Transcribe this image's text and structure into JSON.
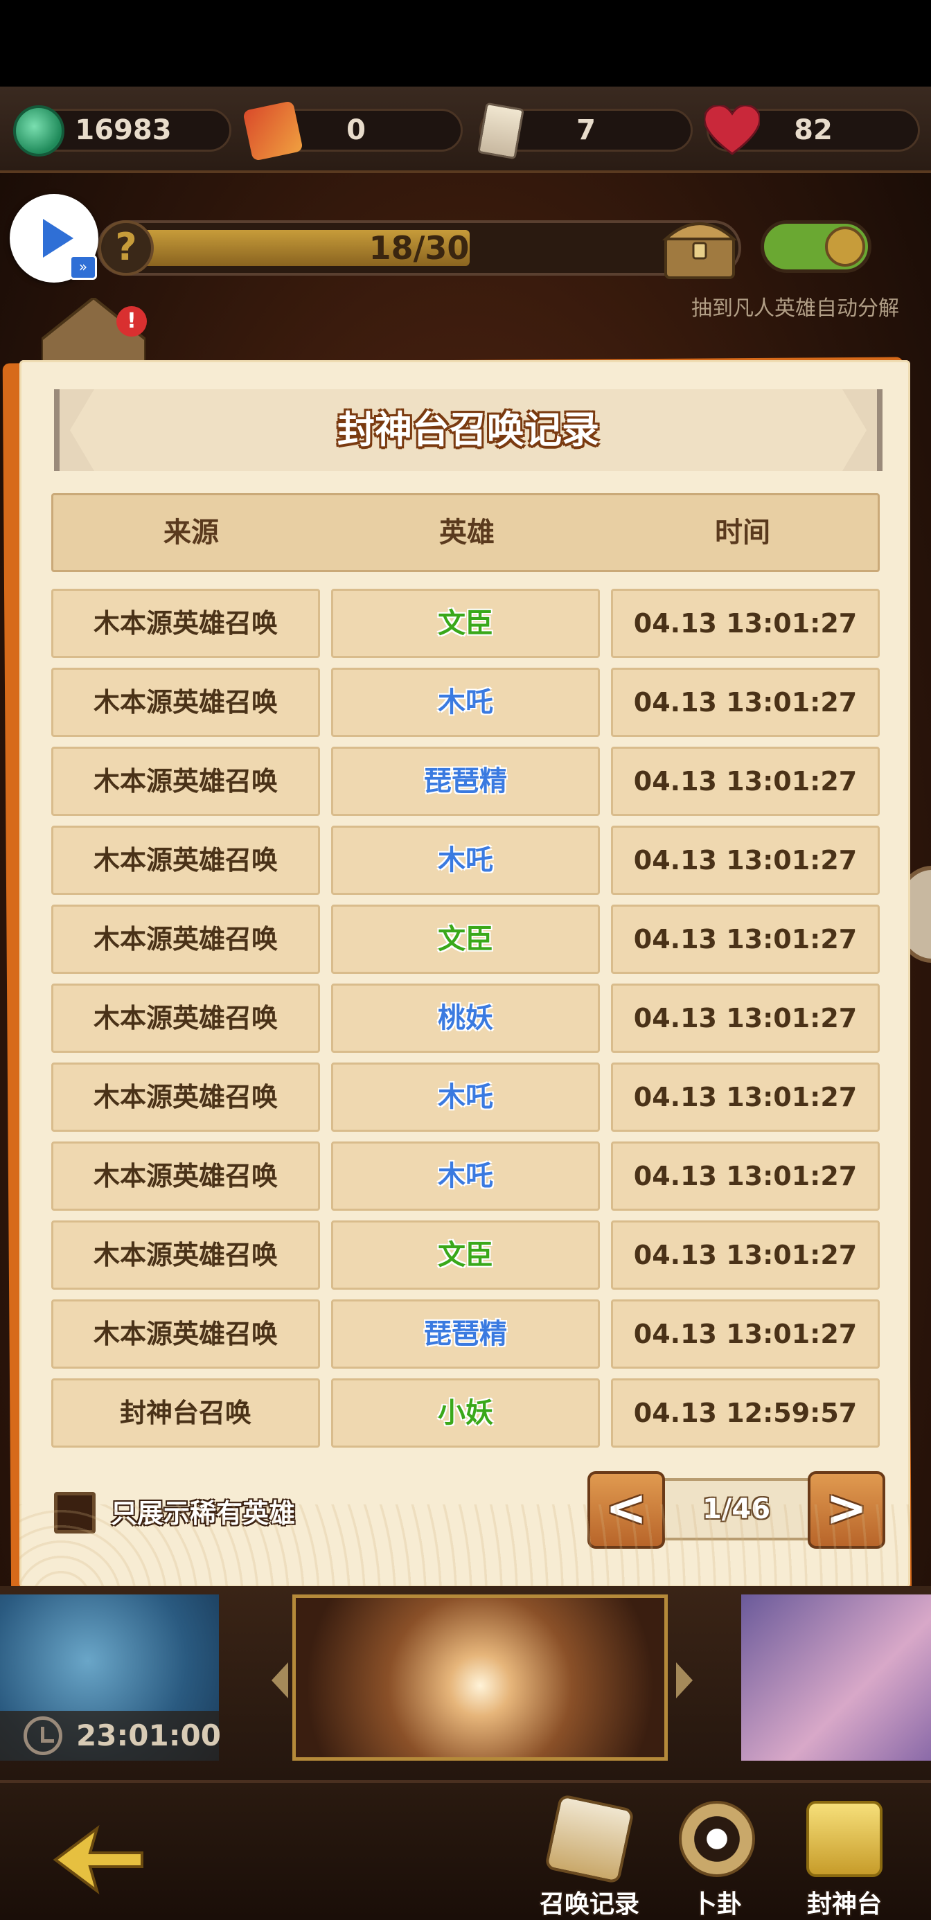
{
  "resources": {
    "jade": "16983",
    "fan": "0",
    "scroll": "7",
    "heart": "82"
  },
  "progress": {
    "text": "18/30",
    "current": 18,
    "max": 30
  },
  "auto_decompose_label": "抽到凡人英雄自动分解",
  "dialog": {
    "title": "封神台召唤记录",
    "headers": [
      "来源",
      "英雄",
      "时间"
    ],
    "rows": [
      {
        "source": "木本源英雄召唤",
        "hero": "文臣",
        "rarity_color": "green",
        "time": "04.13 13:01:27"
      },
      {
        "source": "木本源英雄召唤",
        "hero": "木吒",
        "rarity_color": "blue",
        "time": "04.13 13:01:27"
      },
      {
        "source": "木本源英雄召唤",
        "hero": "琵琶精",
        "rarity_color": "blue",
        "time": "04.13 13:01:27"
      },
      {
        "source": "木本源英雄召唤",
        "hero": "木吒",
        "rarity_color": "blue",
        "time": "04.13 13:01:27"
      },
      {
        "source": "木本源英雄召唤",
        "hero": "文臣",
        "rarity_color": "green",
        "time": "04.13 13:01:27"
      },
      {
        "source": "木本源英雄召唤",
        "hero": "桃妖",
        "rarity_color": "blue",
        "time": "04.13 13:01:27"
      },
      {
        "source": "木本源英雄召唤",
        "hero": "木吒",
        "rarity_color": "blue",
        "time": "04.13 13:01:27"
      },
      {
        "source": "木本源英雄召唤",
        "hero": "木吒",
        "rarity_color": "blue",
        "time": "04.13 13:01:27"
      },
      {
        "source": "木本源英雄召唤",
        "hero": "文臣",
        "rarity_color": "green",
        "time": "04.13 13:01:27"
      },
      {
        "source": "木本源英雄召唤",
        "hero": "琵琶精",
        "rarity_color": "blue",
        "time": "04.13 13:01:27"
      },
      {
        "source": "封神台召唤",
        "hero": "小妖",
        "rarity_color": "green",
        "time": "04.13 12:59:57"
      }
    ],
    "filter_label": "只展示稀有英雄",
    "filter_checked": false,
    "pager": {
      "prev": "<",
      "next": ">",
      "display": "1/46"
    }
  },
  "timer": "23:01:00",
  "nav": {
    "summon_record": "召唤记录",
    "divination": "卜卦",
    "fengshen": "封神台"
  },
  "colors": {
    "green": "#3aa81a",
    "blue": "#3a7ae0",
    "dialog_bg": "#f7ecd3",
    "accent_orange": "#d76a1a"
  }
}
